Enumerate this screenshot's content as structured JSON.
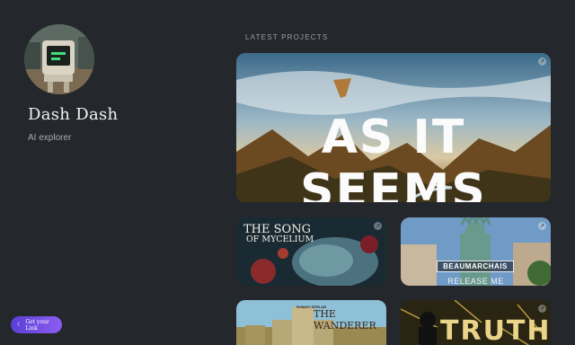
{
  "profile": {
    "name": "Dash Dash",
    "bio": "AI explorer",
    "avatar_icon": "retro-computer-robot-avatar"
  },
  "cta": {
    "label": "Get your Link",
    "icon": "moon-icon"
  },
  "projects": {
    "section_label": "LATEST PROJECTS",
    "items": [
      {
        "title": "AS IT SEEMS"
      },
      {
        "title_line1": "THE SONG",
        "title_line2": "OF MYCELIUM"
      },
      {
        "title": "BEAUMARCHAIS",
        "subtitle": "RELEASE ME"
      },
      {
        "small_text": "RUMAYI SERLAB",
        "title": "THE WANDERER"
      },
      {
        "title": "TRUTH"
      }
    ]
  },
  "colors": {
    "background": "#24272b",
    "accent_gradient_start": "#5a3fd6",
    "accent_gradient_end": "#8d5cf0"
  }
}
